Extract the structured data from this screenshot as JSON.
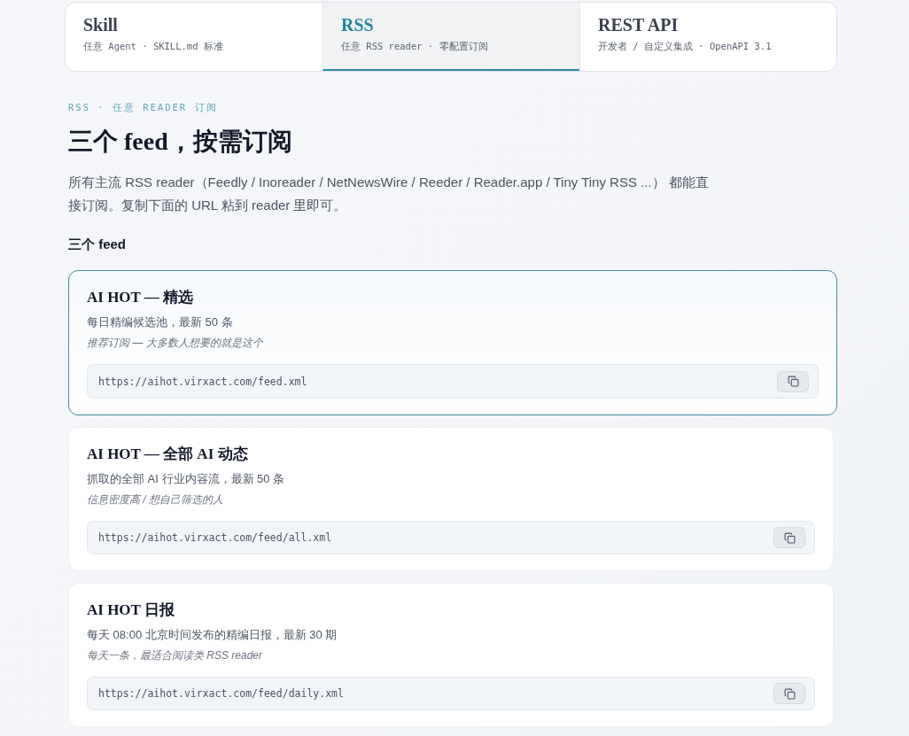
{
  "tabs": [
    {
      "title": "Skill",
      "subtitle": "任意 Agent · SKILL.md 标准",
      "selected": false
    },
    {
      "title": "RSS",
      "subtitle": "任意 RSS reader · 零配置订阅",
      "selected": true
    },
    {
      "title": "REST API",
      "subtitle": "开发者 / 自定义集成 · OpenAPI 3.1",
      "selected": false
    }
  ],
  "section": {
    "eyebrow": "RSS · 任意 READER 订阅",
    "heading": "三个 feed，按需订阅",
    "intro": "所有主流 RSS reader（Feedly / Inoreader / NetNewsWire / Reeder / Reader.app / Tiny Tiny RSS ...） 都能直接订阅。复制下面的 URL 粘到 reader 里即可。",
    "list_heading": "三个 feed"
  },
  "feeds": [
    {
      "title": "AI HOT — 精选",
      "description": "每日精编候选池，最新 50 条",
      "note": "推荐订阅 — 大多数人想要的就是这个",
      "url": "https://aihot.virxact.com/feed.xml",
      "selected": true
    },
    {
      "title": "AI HOT — 全部 AI 动态",
      "description": "抓取的全部 AI 行业内容流，最新 50 条",
      "note": "信息密度高 / 想自己筛选的人",
      "url": "https://aihot.virxact.com/feed/all.xml",
      "selected": false
    },
    {
      "title": "AI HOT 日报",
      "description": "每天 08:00 北京时间发布的精编日报，最新 30 期",
      "note": "每天一条，最适合阅读类 RSS reader",
      "url": "https://aihot.virxact.com/feed/daily.xml",
      "selected": false
    }
  ]
}
